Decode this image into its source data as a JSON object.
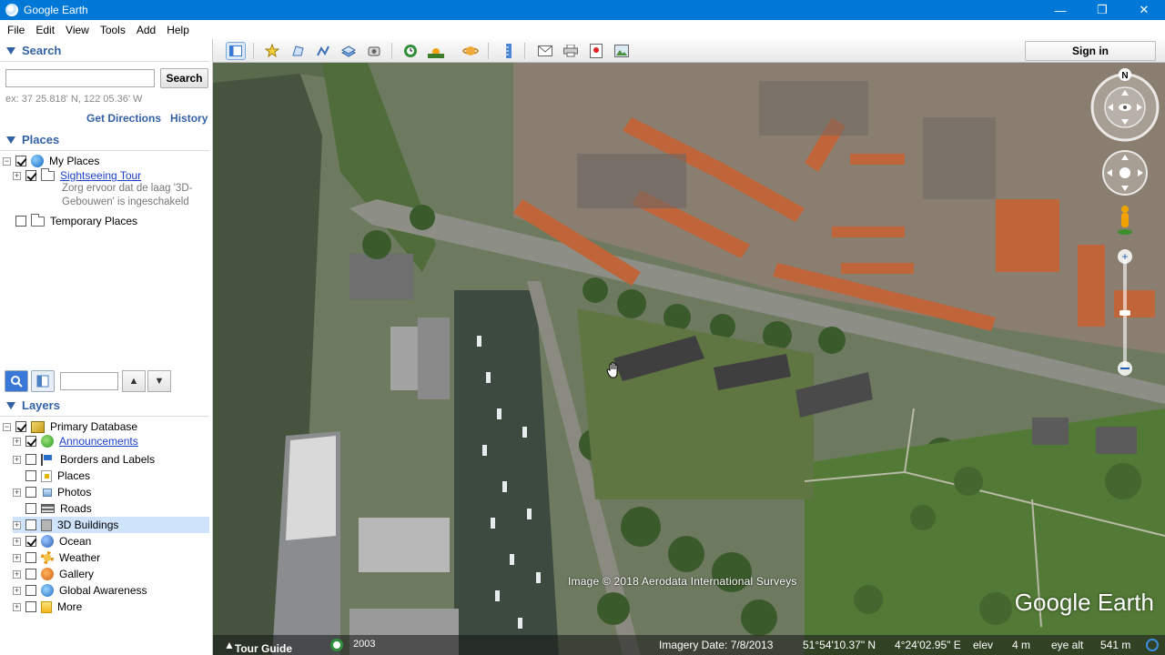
{
  "window": {
    "title": "Google Earth"
  },
  "menu": [
    "File",
    "Edit",
    "View",
    "Tools",
    "Add",
    "Help"
  ],
  "search": {
    "header": "Search",
    "button": "Search",
    "input_value": "",
    "hint": "ex: 37 25.818' N, 122 05.36' W",
    "get_directions": "Get Directions",
    "history": "History"
  },
  "places": {
    "header": "Places",
    "my_places": "My Places",
    "sightseeing": "Sightseeing Tour",
    "sightseeing_desc": "Zorg ervoor dat de laag '3D-Gebouwen' is ingeschakeld",
    "temporary": "Temporary Places"
  },
  "layers": {
    "header": "Layers",
    "items": [
      {
        "label": "Primary Database",
        "checked": true
      },
      {
        "label": "Announcements",
        "checked": true
      },
      {
        "label": "Borders and Labels",
        "checked": false
      },
      {
        "label": "Places",
        "checked": false
      },
      {
        "label": "Photos",
        "checked": false
      },
      {
        "label": "Roads",
        "checked": false
      },
      {
        "label": "3D Buildings",
        "checked": false
      },
      {
        "label": "Ocean",
        "checked": true
      },
      {
        "label": "Weather",
        "checked": false
      },
      {
        "label": "Gallery",
        "checked": false
      },
      {
        "label": "Global Awareness",
        "checked": false
      },
      {
        "label": "More",
        "checked": false
      }
    ]
  },
  "toolbar": {
    "sign_in": "Sign in"
  },
  "map": {
    "copyright": "Image © 2018 Aerodata International Surveys",
    "logo": "Google Earth",
    "compass_n": "N"
  },
  "status": {
    "tour_guide": "Tour Guide",
    "year": "2003",
    "imagery_date": "Imagery Date: 7/8/2013",
    "lat": "51°54'10.37\" N",
    "lon": "4°24'02.95\" E",
    "elev_label": "elev",
    "elev": "4 m",
    "eye_label": "eye alt",
    "eye": "541 m"
  }
}
